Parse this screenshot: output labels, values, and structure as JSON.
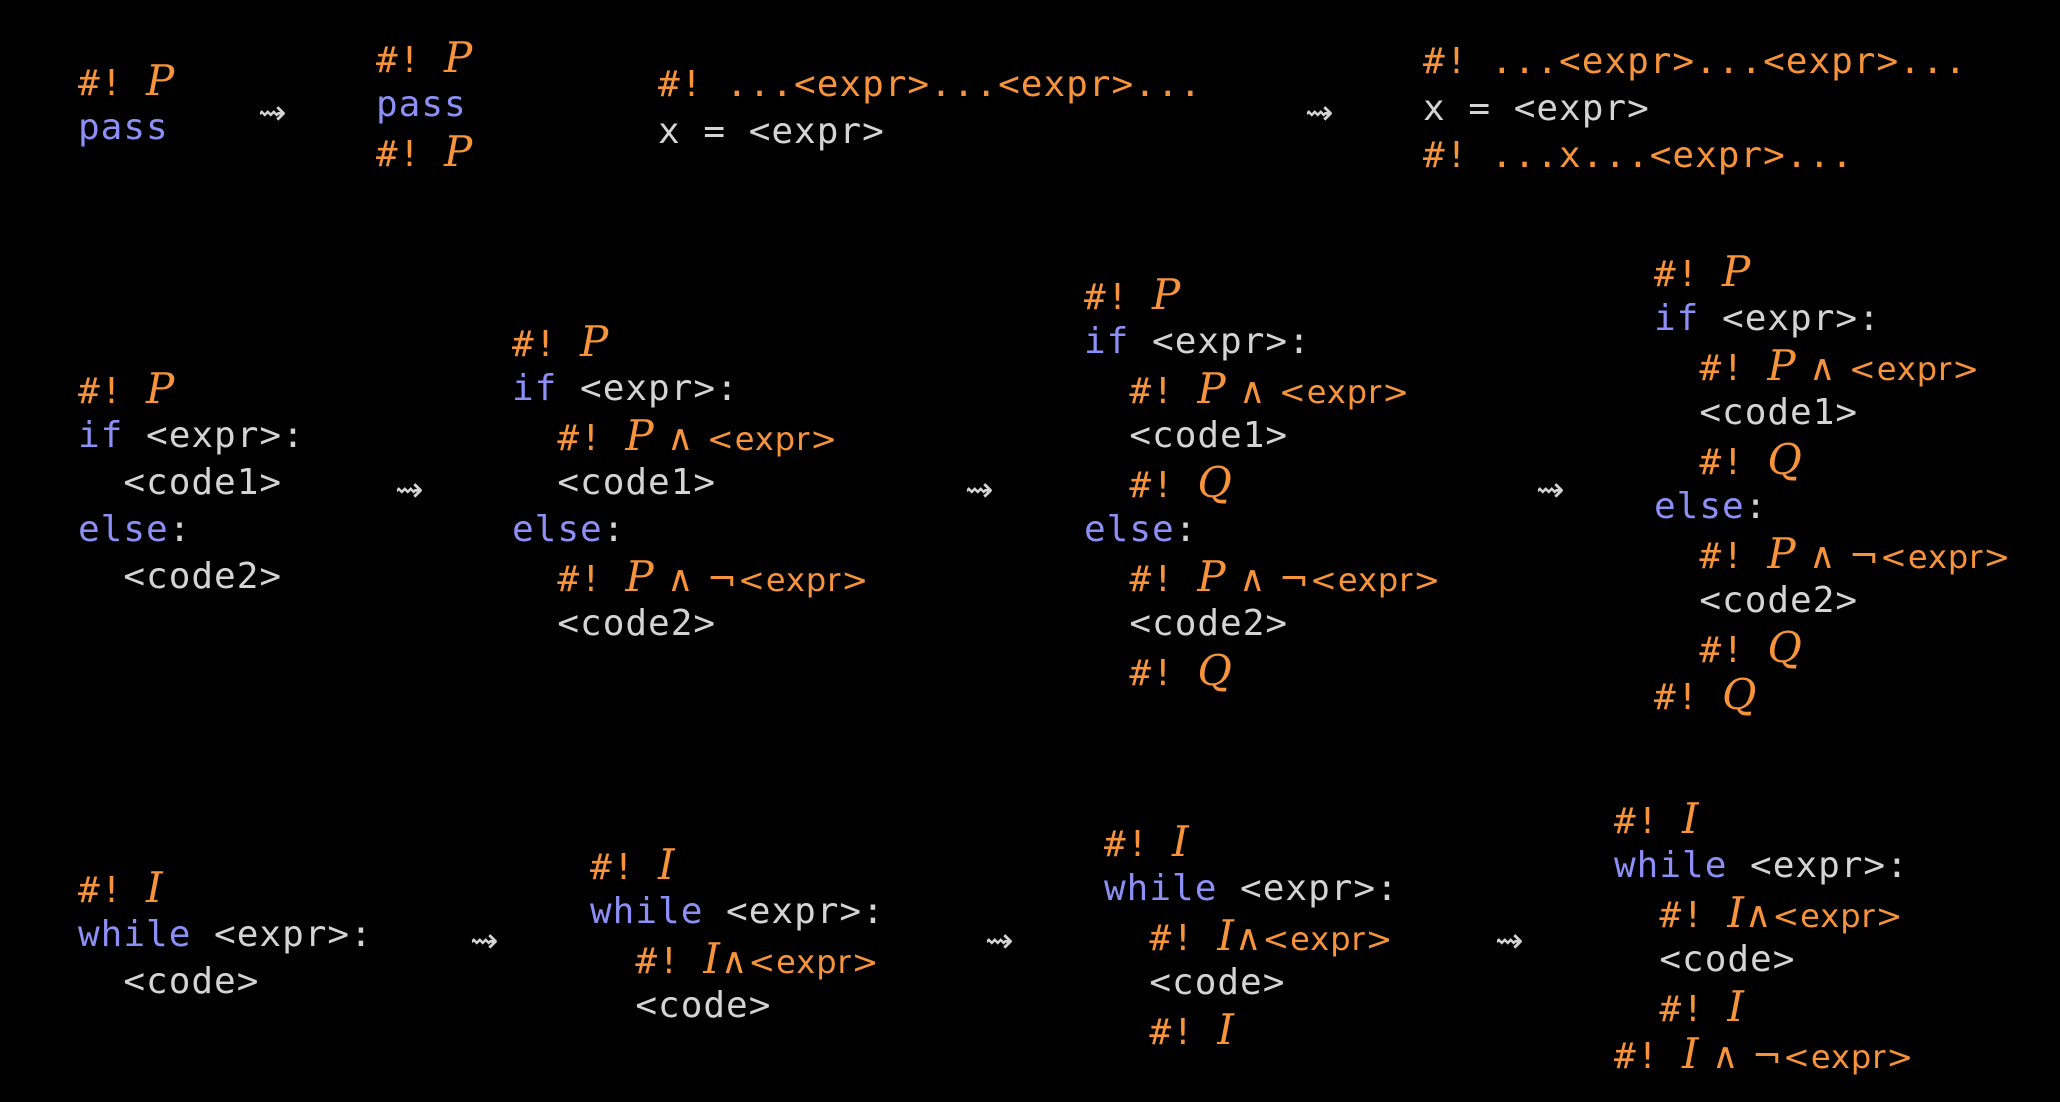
{
  "colors": {
    "background": "#000000",
    "keyword": "#8c8ff5",
    "code_text": "#d4d4d4",
    "annotation": "#f7933b"
  },
  "arrow_symbol": "⇝",
  "blocks": [
    {
      "id": "pass-before",
      "lines": [
        [
          {
            "kind": "ann",
            "text": "#! "
          },
          {
            "kind": "ann-i",
            "text": "P"
          }
        ],
        [
          {
            "kind": "kw",
            "text": "pass"
          }
        ]
      ]
    },
    {
      "id": "pass-after",
      "lines": [
        [
          {
            "kind": "ann",
            "text": "#! "
          },
          {
            "kind": "ann-i",
            "text": "P"
          }
        ],
        [
          {
            "kind": "kw",
            "text": "pass"
          }
        ],
        [
          {
            "kind": "ann",
            "text": "#! "
          },
          {
            "kind": "ann-i",
            "text": "P"
          }
        ]
      ]
    },
    {
      "id": "assign-before",
      "lines": [
        [
          {
            "kind": "ann",
            "text": "#! ...<expr>...<expr>..."
          }
        ],
        [
          {
            "kind": "txt",
            "text": "x = <expr>"
          }
        ]
      ]
    },
    {
      "id": "assign-after",
      "lines": [
        [
          {
            "kind": "ann",
            "text": "#! ...<expr>...<expr>..."
          }
        ],
        [
          {
            "kind": "txt",
            "text": "x = <expr>"
          }
        ],
        [
          {
            "kind": "ann",
            "text": "#! ...x...<expr>..."
          }
        ]
      ]
    },
    {
      "id": "if-step-1",
      "lines": [
        [
          {
            "kind": "ann",
            "text": "#! "
          },
          {
            "kind": "ann-i",
            "text": "P"
          }
        ],
        [
          {
            "kind": "kw",
            "text": "if"
          },
          {
            "kind": "txt",
            "text": " <expr>:"
          }
        ],
        [
          {
            "kind": "txt",
            "text": "  <code1>"
          }
        ],
        [
          {
            "kind": "kw",
            "text": "else"
          },
          {
            "kind": "txt",
            "text": ":"
          }
        ],
        [
          {
            "kind": "txt",
            "text": "  <code2>"
          }
        ]
      ]
    },
    {
      "id": "if-step-2",
      "lines": [
        [
          {
            "kind": "ann",
            "text": "#! "
          },
          {
            "kind": "ann-i",
            "text": "P"
          }
        ],
        [
          {
            "kind": "kw",
            "text": "if"
          },
          {
            "kind": "txt",
            "text": " <expr>:"
          }
        ],
        [
          {
            "kind": "ann",
            "text": "  #! "
          },
          {
            "kind": "ann-i",
            "text": "P"
          },
          {
            "kind": "ann-m",
            "text": " ∧ "
          },
          {
            "kind": "ann-s",
            "text": "<expr>"
          }
        ],
        [
          {
            "kind": "txt",
            "text": "  <code1>"
          }
        ],
        [
          {
            "kind": "kw",
            "text": "else"
          },
          {
            "kind": "txt",
            "text": ":"
          }
        ],
        [
          {
            "kind": "ann",
            "text": "  #! "
          },
          {
            "kind": "ann-i",
            "text": "P"
          },
          {
            "kind": "ann-m",
            "text": " ∧ ¬"
          },
          {
            "kind": "ann-s",
            "text": "<expr>"
          }
        ],
        [
          {
            "kind": "txt",
            "text": "  <code2>"
          }
        ]
      ]
    },
    {
      "id": "if-step-3",
      "lines": [
        [
          {
            "kind": "ann",
            "text": "#! "
          },
          {
            "kind": "ann-i",
            "text": "P"
          }
        ],
        [
          {
            "kind": "kw",
            "text": "if"
          },
          {
            "kind": "txt",
            "text": " <expr>:"
          }
        ],
        [
          {
            "kind": "ann",
            "text": "  #! "
          },
          {
            "kind": "ann-i",
            "text": "P"
          },
          {
            "kind": "ann-m",
            "text": " ∧ "
          },
          {
            "kind": "ann-s",
            "text": "<expr>"
          }
        ],
        [
          {
            "kind": "txt",
            "text": "  <code1>"
          }
        ],
        [
          {
            "kind": "ann",
            "text": "  #! "
          },
          {
            "kind": "ann-i",
            "text": "Q"
          }
        ],
        [
          {
            "kind": "kw",
            "text": "else"
          },
          {
            "kind": "txt",
            "text": ":"
          }
        ],
        [
          {
            "kind": "ann",
            "text": "  #! "
          },
          {
            "kind": "ann-i",
            "text": "P"
          },
          {
            "kind": "ann-m",
            "text": " ∧ ¬"
          },
          {
            "kind": "ann-s",
            "text": "<expr>"
          }
        ],
        [
          {
            "kind": "txt",
            "text": "  <code2>"
          }
        ],
        [
          {
            "kind": "ann",
            "text": "  #! "
          },
          {
            "kind": "ann-i",
            "text": "Q"
          }
        ]
      ]
    },
    {
      "id": "if-step-4",
      "lines": [
        [
          {
            "kind": "ann",
            "text": "#! "
          },
          {
            "kind": "ann-i",
            "text": "P"
          }
        ],
        [
          {
            "kind": "kw",
            "text": "if"
          },
          {
            "kind": "txt",
            "text": " <expr>:"
          }
        ],
        [
          {
            "kind": "ann",
            "text": "  #! "
          },
          {
            "kind": "ann-i",
            "text": "P"
          },
          {
            "kind": "ann-m",
            "text": " ∧ "
          },
          {
            "kind": "ann-s",
            "text": "<expr>"
          }
        ],
        [
          {
            "kind": "txt",
            "text": "  <code1>"
          }
        ],
        [
          {
            "kind": "ann",
            "text": "  #! "
          },
          {
            "kind": "ann-i",
            "text": "Q"
          }
        ],
        [
          {
            "kind": "kw",
            "text": "else"
          },
          {
            "kind": "txt",
            "text": ":"
          }
        ],
        [
          {
            "kind": "ann",
            "text": "  #! "
          },
          {
            "kind": "ann-i",
            "text": "P"
          },
          {
            "kind": "ann-m",
            "text": " ∧ ¬"
          },
          {
            "kind": "ann-s",
            "text": "<expr>"
          }
        ],
        [
          {
            "kind": "txt",
            "text": "  <code2>"
          }
        ],
        [
          {
            "kind": "ann",
            "text": "  #! "
          },
          {
            "kind": "ann-i",
            "text": "Q"
          }
        ],
        [
          {
            "kind": "ann",
            "text": "#! "
          },
          {
            "kind": "ann-i",
            "text": "Q"
          }
        ]
      ]
    },
    {
      "id": "while-step-1",
      "lines": [
        [
          {
            "kind": "ann",
            "text": "#! "
          },
          {
            "kind": "ann-i",
            "text": "I"
          }
        ],
        [
          {
            "kind": "kw",
            "text": "while"
          },
          {
            "kind": "txt",
            "text": " <expr>:"
          }
        ],
        [
          {
            "kind": "txt",
            "text": "  <code>"
          }
        ]
      ]
    },
    {
      "id": "while-step-2",
      "lines": [
        [
          {
            "kind": "ann",
            "text": "#! "
          },
          {
            "kind": "ann-i",
            "text": "I"
          }
        ],
        [
          {
            "kind": "kw",
            "text": "while"
          },
          {
            "kind": "txt",
            "text": " <expr>:"
          }
        ],
        [
          {
            "kind": "ann",
            "text": "  #! "
          },
          {
            "kind": "ann-i",
            "text": "I"
          },
          {
            "kind": "ann-m",
            "text": "∧"
          },
          {
            "kind": "ann-s",
            "text": "<expr>"
          }
        ],
        [
          {
            "kind": "txt",
            "text": "  <code>"
          }
        ]
      ]
    },
    {
      "id": "while-step-3",
      "lines": [
        [
          {
            "kind": "ann",
            "text": "#! "
          },
          {
            "kind": "ann-i",
            "text": "I"
          }
        ],
        [
          {
            "kind": "kw",
            "text": "while"
          },
          {
            "kind": "txt",
            "text": " <expr>:"
          }
        ],
        [
          {
            "kind": "ann",
            "text": "  #! "
          },
          {
            "kind": "ann-i",
            "text": "I"
          },
          {
            "kind": "ann-m",
            "text": "∧"
          },
          {
            "kind": "ann-s",
            "text": "<expr>"
          }
        ],
        [
          {
            "kind": "txt",
            "text": "  <code>"
          }
        ],
        [
          {
            "kind": "ann",
            "text": "  #! "
          },
          {
            "kind": "ann-i",
            "text": "I"
          }
        ]
      ]
    },
    {
      "id": "while-step-4",
      "lines": [
        [
          {
            "kind": "ann",
            "text": "#! "
          },
          {
            "kind": "ann-i",
            "text": "I"
          }
        ],
        [
          {
            "kind": "kw",
            "text": "while"
          },
          {
            "kind": "txt",
            "text": " <expr>:"
          }
        ],
        [
          {
            "kind": "ann",
            "text": "  #! "
          },
          {
            "kind": "ann-i",
            "text": "I"
          },
          {
            "kind": "ann-m",
            "text": "∧"
          },
          {
            "kind": "ann-s",
            "text": "<expr>"
          }
        ],
        [
          {
            "kind": "txt",
            "text": "  <code>"
          }
        ],
        [
          {
            "kind": "ann",
            "text": "  #! "
          },
          {
            "kind": "ann-i",
            "text": "I"
          }
        ],
        [
          {
            "kind": "ann",
            "text": "#! "
          },
          {
            "kind": "ann-i",
            "text": "I"
          },
          {
            "kind": "ann-m",
            "text": " ∧ ¬"
          },
          {
            "kind": "ann-s",
            "text": "<expr>"
          }
        ]
      ]
    }
  ]
}
